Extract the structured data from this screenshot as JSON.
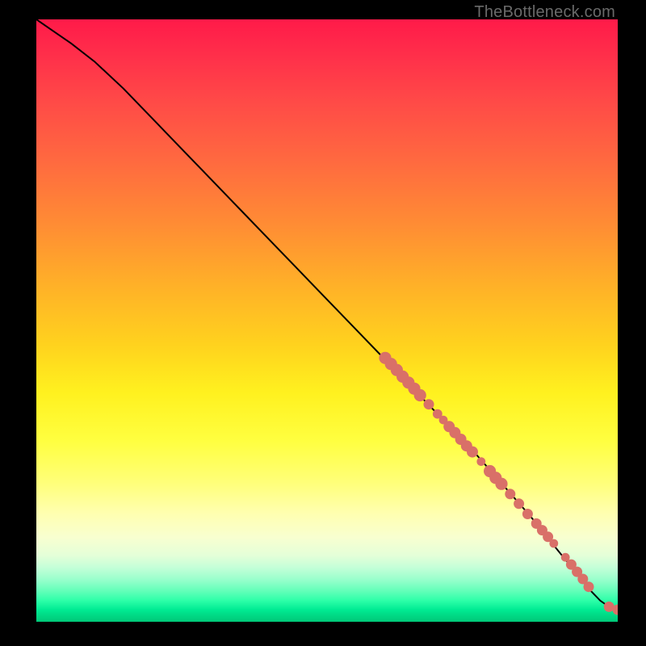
{
  "watermark": "TheBottleneck.com",
  "colors": {
    "curve": "#000000",
    "marker": "#d97068",
    "page_bg": "#000000"
  },
  "chart_data": {
    "type": "line",
    "title": "",
    "xlabel": "",
    "ylabel": "",
    "xlim": [
      0,
      100
    ],
    "ylim": [
      0,
      100
    ],
    "series": [
      {
        "name": "curve",
        "x": [
          0,
          3,
          6,
          10,
          15,
          20,
          25,
          30,
          35,
          40,
          45,
          50,
          55,
          60,
          65,
          70,
          75,
          80,
          85,
          90,
          93,
          95,
          97,
          98.5,
          100
        ],
        "y": [
          100,
          98,
          96,
          93,
          88.5,
          83.5,
          78.5,
          73.5,
          68.5,
          63.5,
          58.5,
          53.5,
          48.5,
          43.5,
          38.5,
          33.5,
          28.5,
          23,
          17.5,
          11.5,
          8,
          5.5,
          3.5,
          2.5,
          2
        ]
      }
    ],
    "markers": [
      {
        "x": 60.0,
        "y": 43.8,
        "r": 1.4
      },
      {
        "x": 61.0,
        "y": 42.8,
        "r": 1.4
      },
      {
        "x": 62.0,
        "y": 41.8,
        "r": 1.4
      },
      {
        "x": 63.0,
        "y": 40.7,
        "r": 1.4
      },
      {
        "x": 64.0,
        "y": 39.7,
        "r": 1.4
      },
      {
        "x": 65.0,
        "y": 38.7,
        "r": 1.4
      },
      {
        "x": 66.0,
        "y": 37.6,
        "r": 1.4
      },
      {
        "x": 67.5,
        "y": 36.1,
        "r": 1.2
      },
      {
        "x": 69.0,
        "y": 34.5,
        "r": 1.1
      },
      {
        "x": 70.0,
        "y": 33.5,
        "r": 1.0
      },
      {
        "x": 71.0,
        "y": 32.4,
        "r": 1.3
      },
      {
        "x": 72.0,
        "y": 31.4,
        "r": 1.3
      },
      {
        "x": 73.0,
        "y": 30.3,
        "r": 1.3
      },
      {
        "x": 74.0,
        "y": 29.2,
        "r": 1.3
      },
      {
        "x": 75.0,
        "y": 28.2,
        "r": 1.3
      },
      {
        "x": 76.5,
        "y": 26.6,
        "r": 1.0
      },
      {
        "x": 78.0,
        "y": 25.0,
        "r": 1.4
      },
      {
        "x": 79.0,
        "y": 23.9,
        "r": 1.4
      },
      {
        "x": 80.0,
        "y": 22.9,
        "r": 1.4
      },
      {
        "x": 81.5,
        "y": 21.2,
        "r": 1.2
      },
      {
        "x": 83.0,
        "y": 19.6,
        "r": 1.2
      },
      {
        "x": 84.5,
        "y": 17.9,
        "r": 1.2
      },
      {
        "x": 86.0,
        "y": 16.3,
        "r": 1.2
      },
      {
        "x": 87.0,
        "y": 15.2,
        "r": 1.2
      },
      {
        "x": 88.0,
        "y": 14.1,
        "r": 1.2
      },
      {
        "x": 89.0,
        "y": 13.0,
        "r": 1.0
      },
      {
        "x": 91.0,
        "y": 10.7,
        "r": 1.0
      },
      {
        "x": 92.0,
        "y": 9.5,
        "r": 1.2
      },
      {
        "x": 93.0,
        "y": 8.3,
        "r": 1.2
      },
      {
        "x": 94.0,
        "y": 7.1,
        "r": 1.2
      },
      {
        "x": 95.0,
        "y": 5.8,
        "r": 1.2
      },
      {
        "x": 98.5,
        "y": 2.5,
        "r": 1.2
      },
      {
        "x": 100.0,
        "y": 2.0,
        "r": 1.2
      }
    ]
  }
}
